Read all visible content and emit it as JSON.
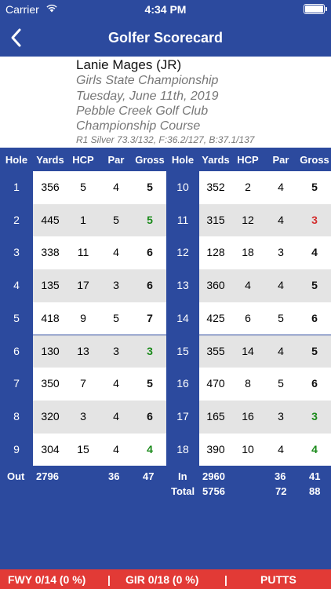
{
  "status": {
    "carrier": "Carrier",
    "time": "4:34 PM"
  },
  "nav": {
    "title": "Golfer Scorecard",
    "back_icon": "chevron-left-icon"
  },
  "info": {
    "name": "Lanie Mages (JR)",
    "event": "Girls State Championship",
    "date": "Tuesday, June 11th, 2019",
    "club": "Pebble Creek Golf Club",
    "course": "Championship Course",
    "tees": "R1 Silver 73.3/132, F:36.2/127, B:37.1/137"
  },
  "headers": [
    "Hole",
    "Yards",
    "HCP",
    "Par",
    "Gross",
    "Hole",
    "Yards",
    "HCP",
    "Par",
    "Gross"
  ],
  "front": [
    {
      "hole": "1",
      "yards": "356",
      "hcp": "5",
      "par": "4",
      "gross": "5"
    },
    {
      "hole": "2",
      "yards": "445",
      "hcp": "1",
      "par": "5",
      "gross": "5"
    },
    {
      "hole": "3",
      "yards": "338",
      "hcp": "11",
      "par": "4",
      "gross": "6"
    },
    {
      "hole": "4",
      "yards": "135",
      "hcp": "17",
      "par": "3",
      "gross": "6"
    },
    {
      "hole": "5",
      "yards": "418",
      "hcp": "9",
      "par": "5",
      "gross": "7"
    },
    {
      "hole": "6",
      "yards": "130",
      "hcp": "13",
      "par": "3",
      "gross": "3"
    },
    {
      "hole": "7",
      "yards": "350",
      "hcp": "7",
      "par": "4",
      "gross": "5"
    },
    {
      "hole": "8",
      "yards": "320",
      "hcp": "3",
      "par": "4",
      "gross": "6"
    },
    {
      "hole": "9",
      "yards": "304",
      "hcp": "15",
      "par": "4",
      "gross": "4"
    }
  ],
  "back": [
    {
      "hole": "10",
      "yards": "352",
      "hcp": "2",
      "par": "4",
      "gross": "5"
    },
    {
      "hole": "11",
      "yards": "315",
      "hcp": "12",
      "par": "4",
      "gross": "3"
    },
    {
      "hole": "12",
      "yards": "128",
      "hcp": "18",
      "par": "3",
      "gross": "4"
    },
    {
      "hole": "13",
      "yards": "360",
      "hcp": "4",
      "par": "4",
      "gross": "5"
    },
    {
      "hole": "14",
      "yards": "425",
      "hcp": "6",
      "par": "5",
      "gross": "6"
    },
    {
      "hole": "15",
      "yards": "355",
      "hcp": "14",
      "par": "4",
      "gross": "5"
    },
    {
      "hole": "16",
      "yards": "470",
      "hcp": "8",
      "par": "5",
      "gross": "6"
    },
    {
      "hole": "17",
      "yards": "165",
      "hcp": "16",
      "par": "3",
      "gross": "3"
    },
    {
      "hole": "18",
      "yards": "390",
      "hcp": "10",
      "par": "4",
      "gross": "4"
    }
  ],
  "totals": {
    "out_label": "Out",
    "out_yards": "2796",
    "out_par": "36",
    "out_gross": "47",
    "in_label": "In",
    "in_yards": "2960",
    "in_par": "36",
    "in_gross": "41",
    "total_label": "Total",
    "total_yards": "5756",
    "total_par": "72",
    "total_gross": "88"
  },
  "bottom": {
    "fwy": "FWY 0/14 (0 %)",
    "sep": "|",
    "gir": "GIR 0/18 (0 %)",
    "putts": "PUTTS"
  },
  "colors": {
    "brand": "#2c4a9e",
    "birdie": "#d32f2f",
    "par": "#1a8a1a",
    "bar": "#e23a36"
  }
}
